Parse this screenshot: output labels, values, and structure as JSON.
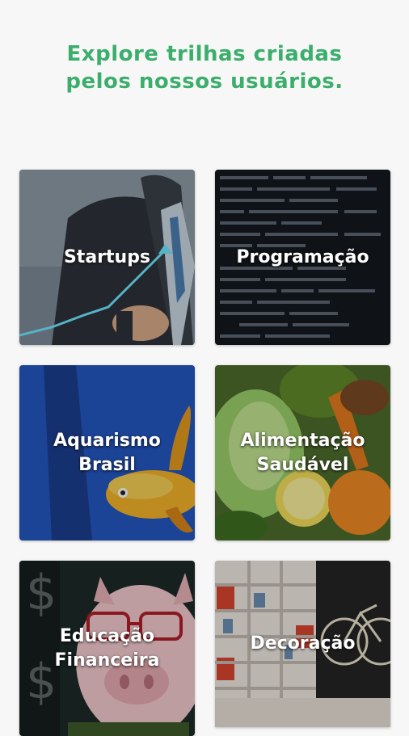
{
  "header": {
    "title_line1": "Explore trilhas criadas",
    "title_line2": "pelos nossos usuários."
  },
  "trails": [
    {
      "label_lines": [
        "Startups"
      ],
      "image": "businessman-growth-chart"
    },
    {
      "label_lines": [
        "Programação"
      ],
      "image": "code-screen"
    },
    {
      "label_lines": [
        "Aquarismo",
        "Brasil"
      ],
      "image": "goldfish"
    },
    {
      "label_lines": [
        "Alimentação",
        "Saudável"
      ],
      "image": "vegetables"
    },
    {
      "label_lines": [
        "Educação",
        "Financeira"
      ],
      "image": "piggy-bank"
    },
    {
      "label_lines": [
        "Decoração"
      ],
      "image": "shelves-bicycle"
    }
  ],
  "colors": {
    "accent": "#3cae6c",
    "background": "#f7f7f7"
  }
}
